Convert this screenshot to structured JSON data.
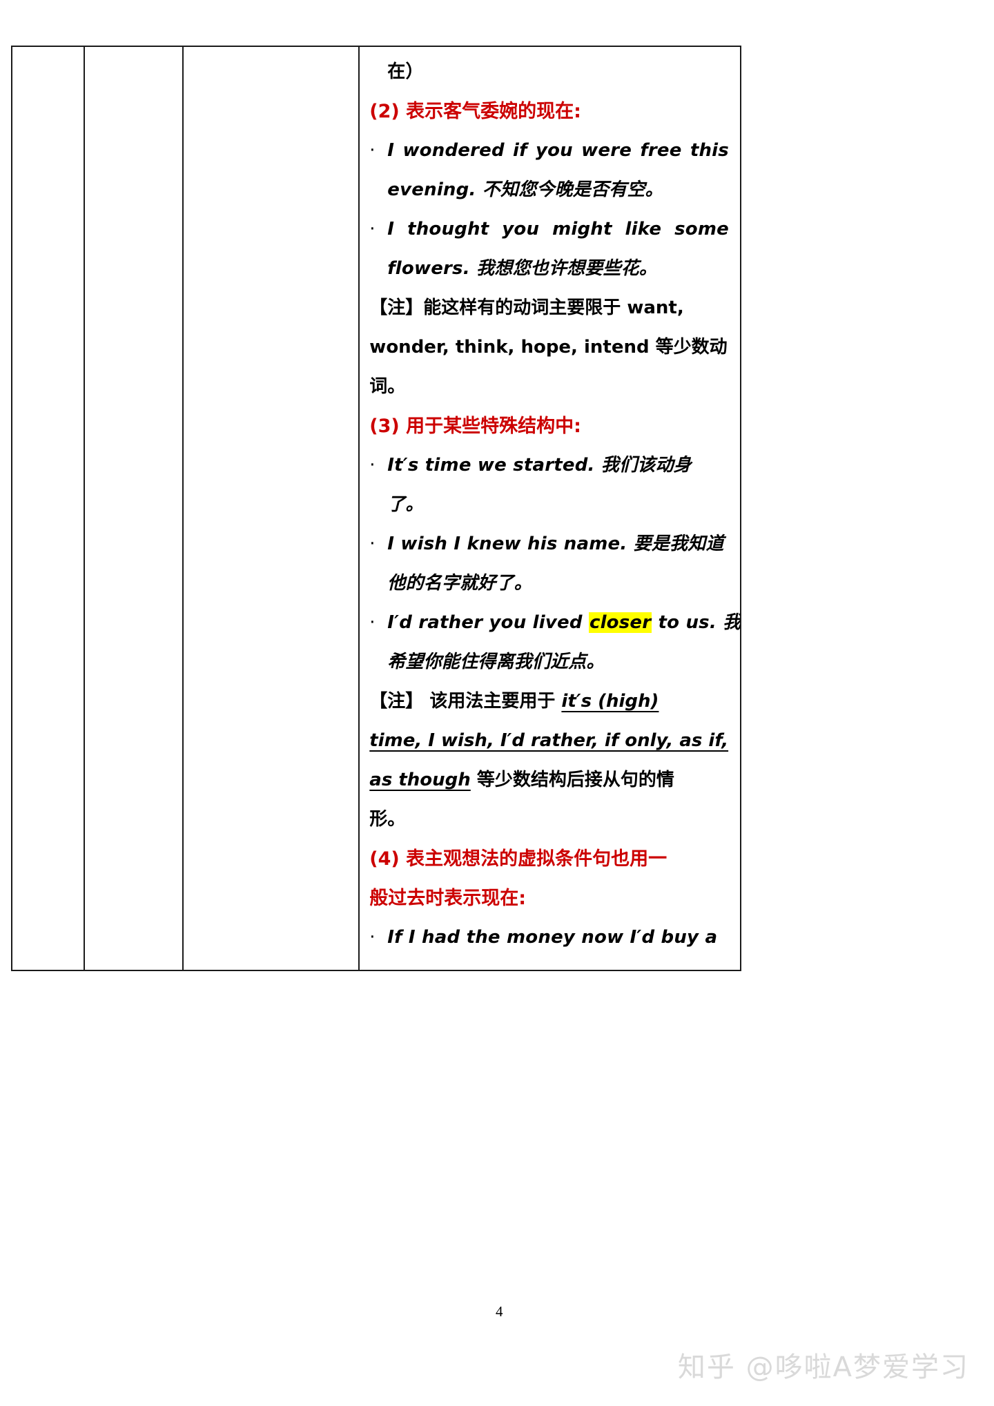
{
  "document": {
    "page_number": "4",
    "watermark": "知乎 @哆啦A梦爱学习",
    "colors": {
      "heading_red": "#cc0000",
      "highlight_yellow": "#ffff00",
      "border": "#1a1a1a",
      "watermark_gray": "#d9d9d9"
    }
  },
  "table": {
    "columns": [
      {
        "id": "col-1",
        "text": ""
      },
      {
        "id": "col-2",
        "text": ""
      },
      {
        "id": "col-3",
        "text": ""
      }
    ]
  },
  "content": {
    "continued_line": "在）",
    "section_2": {
      "heading": "(2) 表示客气委婉的现在:",
      "bullets": [
        {
          "line1_parts": [
            "I",
            "wondered",
            "if",
            "you",
            "were",
            "free",
            "this"
          ],
          "line2": "evening. 不知您今晚是否有空。"
        },
        {
          "line1_parts": [
            "I",
            "thought",
            "you",
            "might",
            "like",
            "some"
          ],
          "line2": "flowers. 我想您也许想要些花。"
        }
      ],
      "note": {
        "line1": "【注】能这样有的动词主要限于 want,",
        "line2": "wonder, think, hope, intend 等少数动",
        "line3": "词。"
      }
    },
    "section_3": {
      "heading": "(3) 用于某些特殊结构中:",
      "bullets": [
        {
          "line1": "It′s time we started. 我们该动身",
          "line2": "了。"
        },
        {
          "line1": "I wish I knew his name. 要是我知道",
          "line2": "他的名字就好了。"
        },
        {
          "line1_pre": "I′d rather you lived ",
          "line1_highlight": "closer",
          "line1_post": " to us. 我",
          "line2": "希望你能住得离我们近点。"
        }
      ],
      "note": {
        "line1_prefix": "【注】 该用法主要用于 ",
        "line1_underline": "it′s (high)",
        "line2_underline": "time, I wish, I′d rather, if only, as if,",
        "line3_underline": "as though",
        "line3_rest": " 等少数结构后接从句的情",
        "line4": "形。"
      }
    },
    "section_4": {
      "heading_line1": "(4) 表主观想法的虚拟条件句也用一",
      "heading_line2": "般过去时表示现在:",
      "bullets": [
        {
          "line1": "If I had the money now I′d buy a"
        }
      ]
    }
  }
}
